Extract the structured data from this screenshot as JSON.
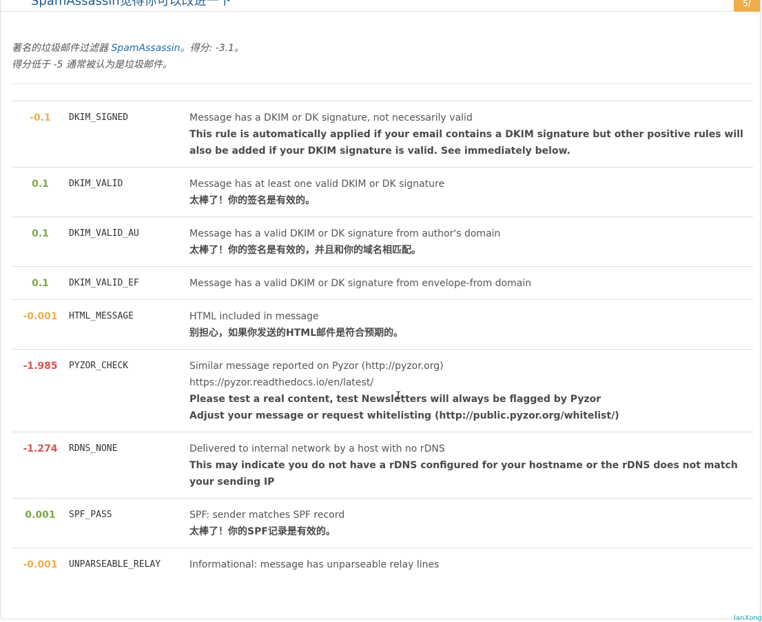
{
  "panel": {
    "title": "SpamAssassin觉得你可以改进一下",
    "corner_badge": "5/"
  },
  "summary": {
    "line1_prefix": "著名的垃圾邮件过滤器 ",
    "line1_link": "SpamAssassin",
    "line1_suffix": "。得分: -3.1。",
    "line2": "得分低于 -5 通常被认为是垃圾邮件。"
  },
  "rules": [
    {
      "score": "-0.1",
      "name": "DKIM_SIGNED",
      "desc": "Message has a DKIM or DK signature, not necessarily valid",
      "notes": [
        "This rule is automatically applied if your email contains a DKIM signature but other positive rules will also be added if your DKIM signature is valid. See immediately below."
      ],
      "color": "#f0ad4e"
    },
    {
      "score": "0.1",
      "name": "DKIM_VALID",
      "desc": "Message has at least one valid DKIM or DK signature",
      "notes": [
        "太棒了！你的签名是有效的。"
      ],
      "color": "#7aaa4a"
    },
    {
      "score": "0.1",
      "name": "DKIM_VALID_AU",
      "desc": "Message has a valid DKIM or DK signature from author's domain",
      "notes": [
        "太棒了！你的签名是有效的，并且和你的域名相匹配。"
      ],
      "color": "#7aaa4a"
    },
    {
      "score": "0.1",
      "name": "DKIM_VALID_EF",
      "desc": "Message has a valid DKIM or DK signature from envelope-from domain",
      "notes": [],
      "color": "#7aaa4a"
    },
    {
      "score": "-0.001",
      "name": "HTML_MESSAGE",
      "desc": "HTML included in message",
      "notes": [
        "别担心，如果你发送的HTML邮件是符合预期的。"
      ],
      "color": "#f0ad4e"
    },
    {
      "score": "-1.985",
      "name": "PYZOR_CHECK",
      "desc": "Similar message reported on Pyzor (http://pyzor.org)",
      "desc2": "https://pyzor.readthedocs.io/en/latest/",
      "notes": [
        "Please test a real content, test Newsletters will always be flagged by Pyzor",
        "Adjust your message or request whitelisting (http://public.pyzor.org/whitelist/)"
      ],
      "color": "#d9534f"
    },
    {
      "score": "-1.274",
      "name": "RDNS_NONE",
      "desc": "Delivered to internal network by a host with no rDNS",
      "notes": [
        "This may indicate you do not have a rDNS configured for your hostname or the rDNS does not match your sending IP"
      ],
      "color": "#d9534f"
    },
    {
      "score": "0.001",
      "name": "SPF_PASS",
      "desc": "SPF: sender matches SPF record",
      "notes": [
        "太棒了！你的SPF记录是有效的。"
      ],
      "color": "#7aaa4a"
    },
    {
      "score": "-0.001",
      "name": "UNPARSEABLE_RELAY",
      "desc": "Informational: message has unparseable relay lines",
      "notes": [],
      "color": "#f0ad4e"
    }
  ],
  "watermark": "lanXong"
}
